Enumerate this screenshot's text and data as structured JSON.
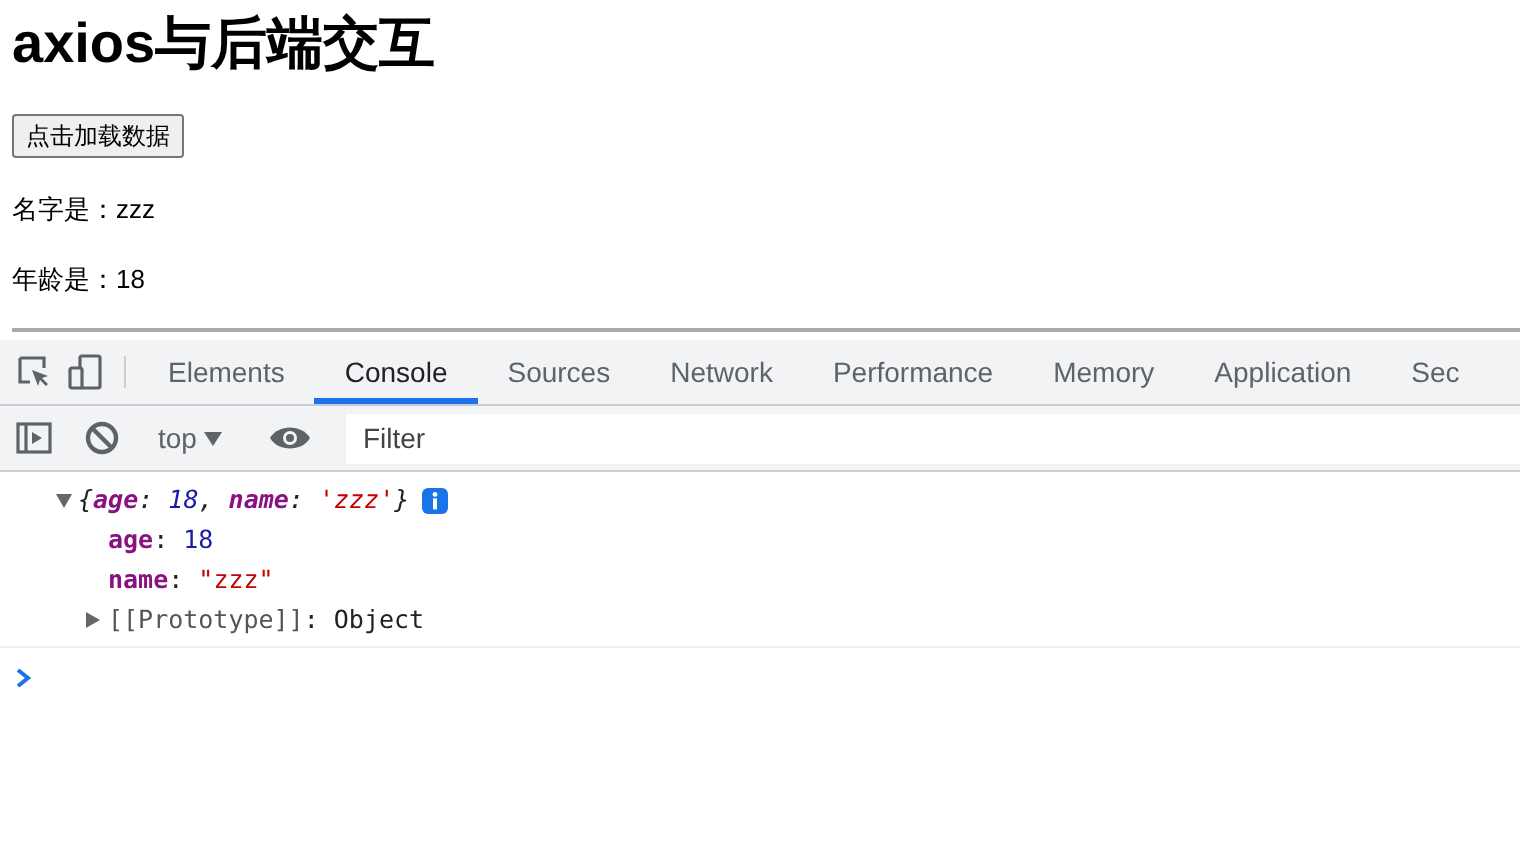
{
  "page": {
    "heading": "axios与后端交互",
    "load_button": "点击加载数据",
    "lines": [
      "名字是：zzz",
      "年龄是：18"
    ]
  },
  "devtools": {
    "tabs": [
      {
        "label": "Elements",
        "selected": false
      },
      {
        "label": "Console",
        "selected": true
      },
      {
        "label": "Sources",
        "selected": false
      },
      {
        "label": "Network",
        "selected": false
      },
      {
        "label": "Performance",
        "selected": false
      },
      {
        "label": "Memory",
        "selected": false
      },
      {
        "label": "Application",
        "selected": false
      },
      {
        "label": "Sec",
        "selected": false
      }
    ],
    "context": "top",
    "filter_placeholder": "Filter",
    "log": {
      "expanded": true,
      "summary": [
        {
          "text": "{",
          "kind": "punct"
        },
        {
          "text": "age",
          "kind": "key"
        },
        {
          "text": ": ",
          "kind": "punct"
        },
        {
          "text": "18",
          "kind": "number"
        },
        {
          "text": ", ",
          "kind": "punct"
        },
        {
          "text": "name",
          "kind": "key"
        },
        {
          "text": ": ",
          "kind": "punct"
        },
        {
          "text": "'zzz'",
          "kind": "string"
        },
        {
          "text": "}",
          "kind": "punct"
        }
      ],
      "properties": [
        {
          "key": "age",
          "separator": ": ",
          "value": "18",
          "kind": "number"
        },
        {
          "key": "name",
          "separator": ": ",
          "value": "\"zzz\"",
          "kind": "string"
        },
        {
          "key": "[[Prototype]]",
          "separator": ": ",
          "value": "Object",
          "kind": "internal",
          "expanded": false
        }
      ]
    }
  }
}
